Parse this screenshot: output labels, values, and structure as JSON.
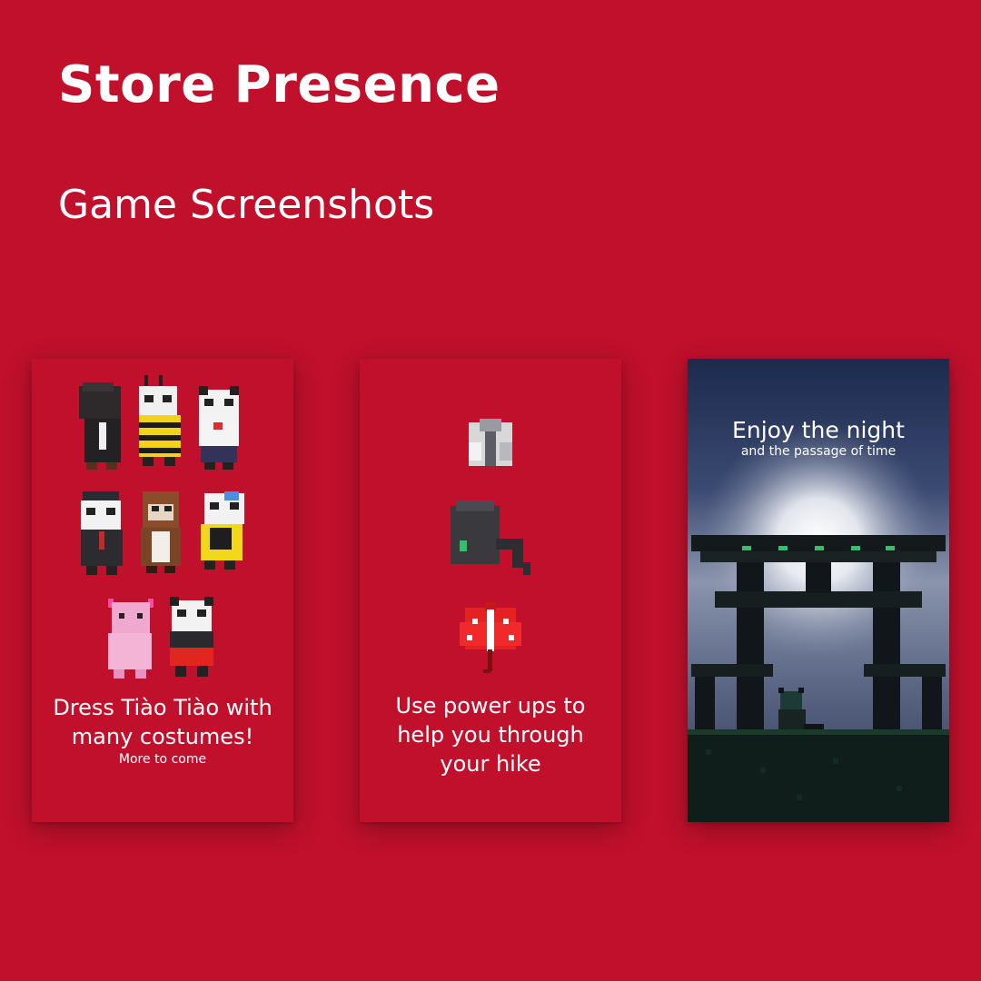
{
  "header": {
    "title": "Store Presence",
    "subtitle": "Game Screenshots"
  },
  "cards": {
    "costumes": {
      "line1": "Dress Tiào Tiào with",
      "line2": "many costumes!",
      "sub": "More to come"
    },
    "powerups": {
      "line1": "Use power ups to",
      "line2": "help you through",
      "line3": "your hike"
    },
    "night": {
      "title": "Enjoy the night",
      "sub": "and the passage of time"
    }
  },
  "colors": {
    "background": "#c0102c",
    "text": "#ffffff",
    "panda_black": "#2a2a2e",
    "panda_white": "#f4f4f4",
    "night_sky_top": "#1d2a4e",
    "gate_dark": "#141a1c",
    "gate_accent": "#2ec26a"
  }
}
